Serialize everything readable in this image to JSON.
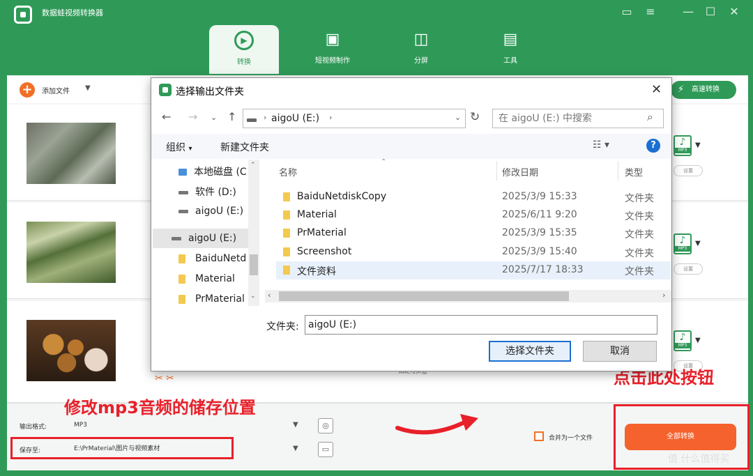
{
  "app": {
    "title": "数据蛙视频转换器"
  },
  "tabs": [
    {
      "label": "转换"
    },
    {
      "label": "短视频制作"
    },
    {
      "label": "分屏"
    },
    {
      "label": "工具"
    }
  ],
  "toolbar": {
    "add_file": "添加文件",
    "high_speed": "高速转换"
  },
  "rows": [
    {
      "format": "MP3",
      "settings": "设置"
    },
    {
      "format": "MP3",
      "settings": "设置"
    },
    {
      "format": "MP3",
      "settings": "设置"
    }
  ],
  "row3": {
    "audio_select": "AAC-2声道"
  },
  "bottom": {
    "output_format_label": "输出格式:",
    "output_format_value": "MP3",
    "save_to_label": "保存至:",
    "save_to_value": "E:\\PrMaterial\\图片与视频素材",
    "merge_label": "合并为一个文件",
    "convert_all": "全部转换"
  },
  "annotations": {
    "modify_path": "修改mp3音频的储存位置",
    "click_here": "点击此处按钮"
  },
  "watermark": "值 什么值得买",
  "dialog": {
    "title": "选择输出文件夹",
    "address": "aigoU (E:)",
    "search_placeholder": "在 aigoU (E:) 中搜索",
    "organize": "组织",
    "new_folder": "新建文件夹",
    "help": "?",
    "nav_tree": [
      "本地磁盘 (C",
      "软件 (D:)",
      "aigoU (E:)",
      "aigoU (E:)",
      "BaiduNetd",
      "Material",
      "PrMaterial"
    ],
    "columns": {
      "name": "名称",
      "date": "修改日期",
      "type": "类型"
    },
    "files": [
      {
        "name": "BaiduNetdiskCopy",
        "date": "2025/3/9 15:33",
        "type": "文件夹"
      },
      {
        "name": "Material",
        "date": "2025/6/11 9:20",
        "type": "文件夹"
      },
      {
        "name": "PrMaterial",
        "date": "2025/3/9 15:35",
        "type": "文件夹"
      },
      {
        "name": "Screenshot",
        "date": "2025/3/9 15:40",
        "type": "文件夹"
      },
      {
        "name": "文件资料",
        "date": "2025/7/17 18:33",
        "type": "文件夹"
      }
    ],
    "folder_label": "文件夹:",
    "folder_value": "aigoU (E:)",
    "select_button": "选择文件夹",
    "cancel_button": "取消"
  },
  "colors": {
    "brand_green": "#2f9a58",
    "accent_orange": "#f5622d",
    "annotation_red": "#e8202a"
  },
  "icons": [
    "feedback-icon",
    "menu-icon",
    "minimize-icon",
    "maximize-icon",
    "close-icon"
  ]
}
